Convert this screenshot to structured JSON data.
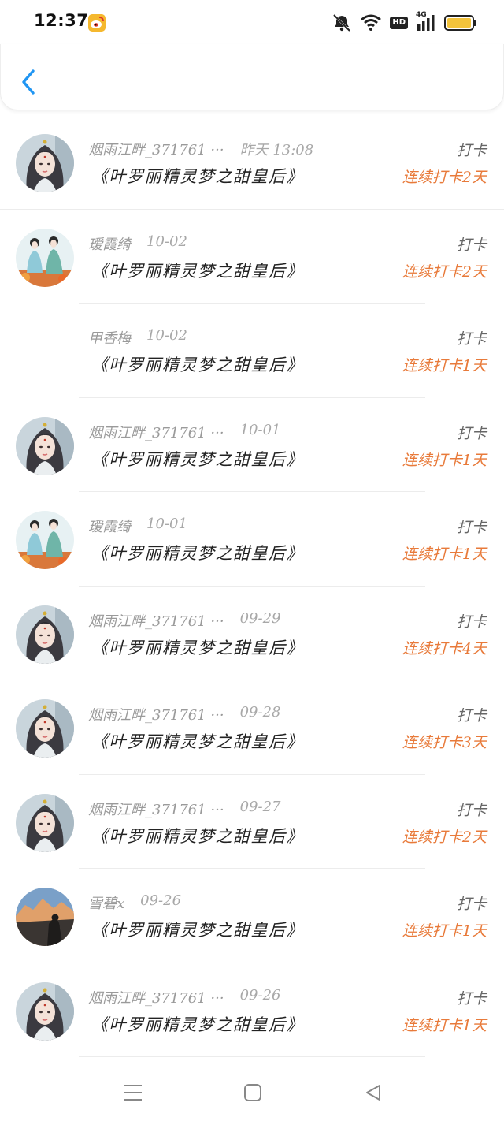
{
  "status": {
    "time": "12:37",
    "network": "4G",
    "hd": "HD"
  },
  "header": {
    "back_icon": "chevron-left-icon",
    "accent": "#2196f3"
  },
  "colors": {
    "streak": "#e87a3a"
  },
  "items": [
    {
      "user": "烟雨江畔_371761 ···",
      "date": "昨天 13:08",
      "title": "《叶罗丽精灵梦之甜皇后》",
      "action": "打卡",
      "streak": "连续打卡2天",
      "avatar": "girl"
    },
    {
      "user": "瑷霞绮",
      "date": "10-02",
      "title": "《叶罗丽精灵梦之甜皇后》",
      "action": "打卡",
      "streak": "连续打卡2天",
      "avatar": "couple"
    },
    {
      "user": "甲香梅",
      "date": "10-02",
      "title": "《叶罗丽精灵梦之甜皇后》",
      "action": "打卡",
      "streak": "连续打卡1天",
      "avatar": "none"
    },
    {
      "user": "烟雨江畔_371761 ···",
      "date": "10-01",
      "title": "《叶罗丽精灵梦之甜皇后》",
      "action": "打卡",
      "streak": "连续打卡1天",
      "avatar": "girl"
    },
    {
      "user": "瑷霞绮",
      "date": "10-01",
      "title": "《叶罗丽精灵梦之甜皇后》",
      "action": "打卡",
      "streak": "连续打卡1天",
      "avatar": "couple"
    },
    {
      "user": "烟雨江畔_371761 ···",
      "date": "09-29",
      "title": "《叶罗丽精灵梦之甜皇后》",
      "action": "打卡",
      "streak": "连续打卡4天",
      "avatar": "girl"
    },
    {
      "user": "烟雨江畔_371761 ···",
      "date": "09-28",
      "title": "《叶罗丽精灵梦之甜皇后》",
      "action": "打卡",
      "streak": "连续打卡3天",
      "avatar": "girl"
    },
    {
      "user": "烟雨江畔_371761 ···",
      "date": "09-27",
      "title": "《叶罗丽精灵梦之甜皇后》",
      "action": "打卡",
      "streak": "连续打卡2天",
      "avatar": "girl"
    },
    {
      "user": "雪碧x",
      "date": "09-26",
      "title": "《叶罗丽精灵梦之甜皇后》",
      "action": "打卡",
      "streak": "连续打卡1天",
      "avatar": "mountain"
    },
    {
      "user": "烟雨江畔_371761 ···",
      "date": "09-26",
      "title": "《叶罗丽精灵梦之甜皇后》",
      "action": "打卡",
      "streak": "连续打卡1天",
      "avatar": "girl"
    }
  ],
  "nav": {
    "menu_icon": "menu-icon",
    "home_icon": "home-square-icon",
    "back_icon": "back-triangle-icon"
  }
}
